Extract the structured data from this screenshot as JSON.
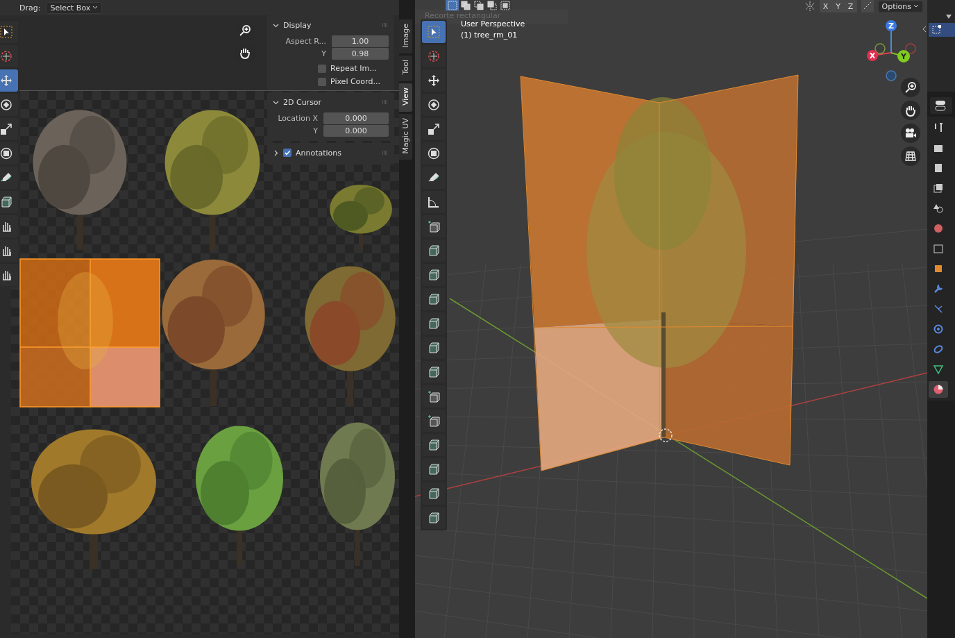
{
  "uv_editor": {
    "header": {
      "drag_label": "Drag:",
      "drag_mode": "Select Box"
    },
    "tools": [
      {
        "kind": "select",
        "selected": false
      },
      {
        "kind": "cursor",
        "selected": false
      },
      {
        "kind": "move",
        "selected": true
      },
      {
        "kind": "rotate",
        "selected": false
      },
      {
        "kind": "scale",
        "selected": false
      },
      {
        "kind": "transform",
        "selected": false
      },
      {
        "kind": "annotate",
        "selected": false
      },
      {
        "kind": "cube",
        "selected": false
      },
      {
        "kind": "grab",
        "selected": false
      },
      {
        "kind": "relax",
        "selected": false
      },
      {
        "kind": "pinch",
        "selected": false
      }
    ],
    "sidebar": {
      "panels": [
        {
          "title": "Display",
          "expanded": true,
          "fields": [
            {
              "label": "Aspect R...",
              "value": "1.00"
            },
            {
              "label": "Y",
              "value": "0.98"
            }
          ],
          "checkboxes": [
            {
              "label": "Repeat Im...",
              "checked": false
            },
            {
              "label": "Pixel Coord...",
              "checked": false
            }
          ]
        },
        {
          "title": "2D Cursor",
          "expanded": true,
          "fields": [
            {
              "label": "Location X",
              "value": "0.000"
            },
            {
              "label": "Y",
              "value": "0.000"
            }
          ]
        },
        {
          "title": "Annotations",
          "expanded": false,
          "checked": true
        }
      ]
    },
    "tabs": [
      {
        "label": "Image",
        "selected": false
      },
      {
        "label": "Tool",
        "selected": false
      },
      {
        "label": "View",
        "selected": true
      },
      {
        "label": "Magic UV",
        "selected": false
      }
    ]
  },
  "viewport": {
    "select_modes": [
      {
        "kind": "new",
        "selected": true
      },
      {
        "kind": "extend",
        "selected": false
      },
      {
        "kind": "subtract",
        "selected": false
      },
      {
        "kind": "invert",
        "selected": false
      },
      {
        "kind": "intersect",
        "selected": false
      }
    ],
    "tooltip": "Recorte rectangular",
    "view_name": "User Perspective",
    "object_name": "(1) tree_rm_01",
    "axis_buttons": [
      "X",
      "Y",
      "Z"
    ],
    "options": "Options",
    "gizmo": {
      "x": "X",
      "y": "Y",
      "z": "Z"
    },
    "tools": [
      {
        "kind": "select",
        "selected": true
      },
      {
        "kind": "cursor",
        "selected": false
      },
      {
        "kind": "move",
        "selected": false
      },
      {
        "kind": "rotate",
        "selected": false
      },
      {
        "kind": "scale",
        "selected": false
      },
      {
        "kind": "transform",
        "selected": false
      },
      {
        "kind": "annotate",
        "selected": false
      },
      {
        "kind": "measure",
        "selected": false
      },
      {
        "kind": "add-cube",
        "selected": false
      },
      {
        "kind": "extrude",
        "selected": false
      },
      {
        "kind": "inset",
        "selected": false
      },
      {
        "kind": "bevel",
        "selected": false
      },
      {
        "kind": "loop-cut",
        "selected": false
      },
      {
        "kind": "knife",
        "selected": false
      },
      {
        "kind": "poly-build",
        "selected": false
      },
      {
        "kind": "spin",
        "selected": false
      },
      {
        "kind": "smooth",
        "selected": false
      },
      {
        "kind": "edge-slide",
        "selected": false
      },
      {
        "kind": "shrink",
        "selected": false
      },
      {
        "kind": "shear",
        "selected": false
      },
      {
        "kind": "rip",
        "selected": false
      }
    ]
  },
  "properties": {
    "tabs": [
      {
        "kind": "tool",
        "selected": false
      },
      {
        "kind": "render",
        "selected": false
      },
      {
        "kind": "output",
        "selected": false
      },
      {
        "kind": "view-layer",
        "selected": false
      },
      {
        "kind": "scene",
        "selected": false
      },
      {
        "kind": "world",
        "selected": false
      },
      {
        "kind": "collection",
        "selected": false
      },
      {
        "kind": "object",
        "selected": false
      },
      {
        "kind": "modifier",
        "selected": false
      },
      {
        "kind": "particles",
        "selected": false
      },
      {
        "kind": "physics",
        "selected": false
      },
      {
        "kind": "constraints",
        "selected": false
      },
      {
        "kind": "data",
        "selected": false
      },
      {
        "kind": "material",
        "selected": true
      }
    ]
  }
}
